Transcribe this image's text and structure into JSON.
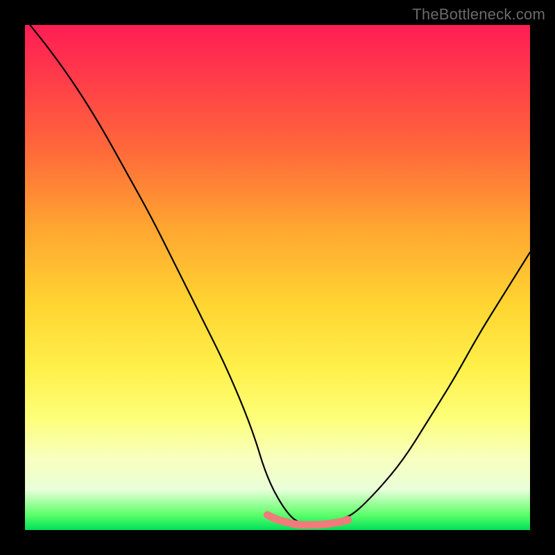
{
  "watermark": "TheBottleneck.com",
  "chart_data": {
    "type": "line",
    "title": "",
    "xlabel": "",
    "ylabel": "",
    "xlim": [
      0,
      100
    ],
    "ylim": [
      0,
      100
    ],
    "gradient_stops": [
      {
        "pos": 0,
        "color": "#ff1d55"
      },
      {
        "pos": 25,
        "color": "#ff6a3a"
      },
      {
        "pos": 55,
        "color": "#ffd431"
      },
      {
        "pos": 86,
        "color": "#f8ffc0"
      },
      {
        "pos": 100,
        "color": "#00e05a"
      }
    ],
    "series": [
      {
        "name": "bottleneck-curve",
        "color": "#000000",
        "x": [
          1,
          5,
          10,
          15,
          20,
          25,
          30,
          35,
          40,
          45,
          48,
          52,
          55,
          58,
          62,
          65,
          70,
          75,
          80,
          85,
          90,
          95,
          100
        ],
        "values": [
          100,
          95,
          88,
          80,
          71,
          62,
          52,
          42,
          32,
          20,
          10,
          3,
          1,
          1,
          2,
          3,
          8,
          14,
          22,
          30,
          39,
          47,
          55
        ]
      },
      {
        "name": "flat-region-marker",
        "color": "#f07b7b",
        "x": [
          48,
          50,
          52,
          54,
          56,
          58,
          60,
          62,
          64
        ],
        "values": [
          3,
          2,
          1.5,
          1,
          1,
          1,
          1.2,
          1.5,
          2
        ]
      }
    ]
  }
}
